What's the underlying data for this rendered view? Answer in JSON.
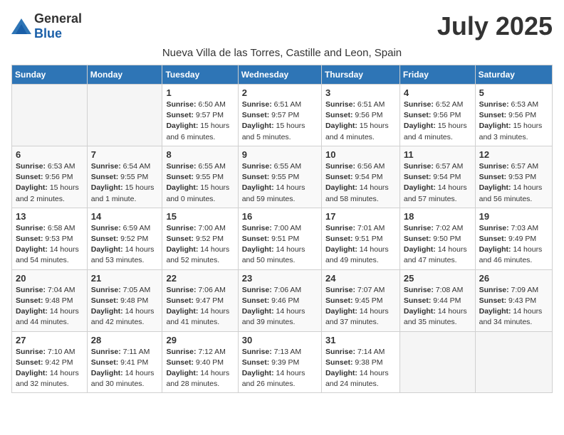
{
  "logo": {
    "general": "General",
    "blue": "Blue"
  },
  "title": "July 2025",
  "subtitle": "Nueva Villa de las Torres, Castille and Leon, Spain",
  "days_of_week": [
    "Sunday",
    "Monday",
    "Tuesday",
    "Wednesday",
    "Thursday",
    "Friday",
    "Saturday"
  ],
  "weeks": [
    [
      {
        "day": "",
        "info": ""
      },
      {
        "day": "",
        "info": ""
      },
      {
        "day": "1",
        "info": "Sunrise: 6:50 AM\nSunset: 9:57 PM\nDaylight: 15 hours and 6 minutes."
      },
      {
        "day": "2",
        "info": "Sunrise: 6:51 AM\nSunset: 9:57 PM\nDaylight: 15 hours and 5 minutes."
      },
      {
        "day": "3",
        "info": "Sunrise: 6:51 AM\nSunset: 9:56 PM\nDaylight: 15 hours and 4 minutes."
      },
      {
        "day": "4",
        "info": "Sunrise: 6:52 AM\nSunset: 9:56 PM\nDaylight: 15 hours and 4 minutes."
      },
      {
        "day": "5",
        "info": "Sunrise: 6:53 AM\nSunset: 9:56 PM\nDaylight: 15 hours and 3 minutes."
      }
    ],
    [
      {
        "day": "6",
        "info": "Sunrise: 6:53 AM\nSunset: 9:56 PM\nDaylight: 15 hours and 2 minutes."
      },
      {
        "day": "7",
        "info": "Sunrise: 6:54 AM\nSunset: 9:55 PM\nDaylight: 15 hours and 1 minute."
      },
      {
        "day": "8",
        "info": "Sunrise: 6:55 AM\nSunset: 9:55 PM\nDaylight: 15 hours and 0 minutes."
      },
      {
        "day": "9",
        "info": "Sunrise: 6:55 AM\nSunset: 9:55 PM\nDaylight: 14 hours and 59 minutes."
      },
      {
        "day": "10",
        "info": "Sunrise: 6:56 AM\nSunset: 9:54 PM\nDaylight: 14 hours and 58 minutes."
      },
      {
        "day": "11",
        "info": "Sunrise: 6:57 AM\nSunset: 9:54 PM\nDaylight: 14 hours and 57 minutes."
      },
      {
        "day": "12",
        "info": "Sunrise: 6:57 AM\nSunset: 9:53 PM\nDaylight: 14 hours and 56 minutes."
      }
    ],
    [
      {
        "day": "13",
        "info": "Sunrise: 6:58 AM\nSunset: 9:53 PM\nDaylight: 14 hours and 54 minutes."
      },
      {
        "day": "14",
        "info": "Sunrise: 6:59 AM\nSunset: 9:52 PM\nDaylight: 14 hours and 53 minutes."
      },
      {
        "day": "15",
        "info": "Sunrise: 7:00 AM\nSunset: 9:52 PM\nDaylight: 14 hours and 52 minutes."
      },
      {
        "day": "16",
        "info": "Sunrise: 7:00 AM\nSunset: 9:51 PM\nDaylight: 14 hours and 50 minutes."
      },
      {
        "day": "17",
        "info": "Sunrise: 7:01 AM\nSunset: 9:51 PM\nDaylight: 14 hours and 49 minutes."
      },
      {
        "day": "18",
        "info": "Sunrise: 7:02 AM\nSunset: 9:50 PM\nDaylight: 14 hours and 47 minutes."
      },
      {
        "day": "19",
        "info": "Sunrise: 7:03 AM\nSunset: 9:49 PM\nDaylight: 14 hours and 46 minutes."
      }
    ],
    [
      {
        "day": "20",
        "info": "Sunrise: 7:04 AM\nSunset: 9:48 PM\nDaylight: 14 hours and 44 minutes."
      },
      {
        "day": "21",
        "info": "Sunrise: 7:05 AM\nSunset: 9:48 PM\nDaylight: 14 hours and 42 minutes."
      },
      {
        "day": "22",
        "info": "Sunrise: 7:06 AM\nSunset: 9:47 PM\nDaylight: 14 hours and 41 minutes."
      },
      {
        "day": "23",
        "info": "Sunrise: 7:06 AM\nSunset: 9:46 PM\nDaylight: 14 hours and 39 minutes."
      },
      {
        "day": "24",
        "info": "Sunrise: 7:07 AM\nSunset: 9:45 PM\nDaylight: 14 hours and 37 minutes."
      },
      {
        "day": "25",
        "info": "Sunrise: 7:08 AM\nSunset: 9:44 PM\nDaylight: 14 hours and 35 minutes."
      },
      {
        "day": "26",
        "info": "Sunrise: 7:09 AM\nSunset: 9:43 PM\nDaylight: 14 hours and 34 minutes."
      }
    ],
    [
      {
        "day": "27",
        "info": "Sunrise: 7:10 AM\nSunset: 9:42 PM\nDaylight: 14 hours and 32 minutes."
      },
      {
        "day": "28",
        "info": "Sunrise: 7:11 AM\nSunset: 9:41 PM\nDaylight: 14 hours and 30 minutes."
      },
      {
        "day": "29",
        "info": "Sunrise: 7:12 AM\nSunset: 9:40 PM\nDaylight: 14 hours and 28 minutes."
      },
      {
        "day": "30",
        "info": "Sunrise: 7:13 AM\nSunset: 9:39 PM\nDaylight: 14 hours and 26 minutes."
      },
      {
        "day": "31",
        "info": "Sunrise: 7:14 AM\nSunset: 9:38 PM\nDaylight: 14 hours and 24 minutes."
      },
      {
        "day": "",
        "info": ""
      },
      {
        "day": "",
        "info": ""
      }
    ]
  ]
}
